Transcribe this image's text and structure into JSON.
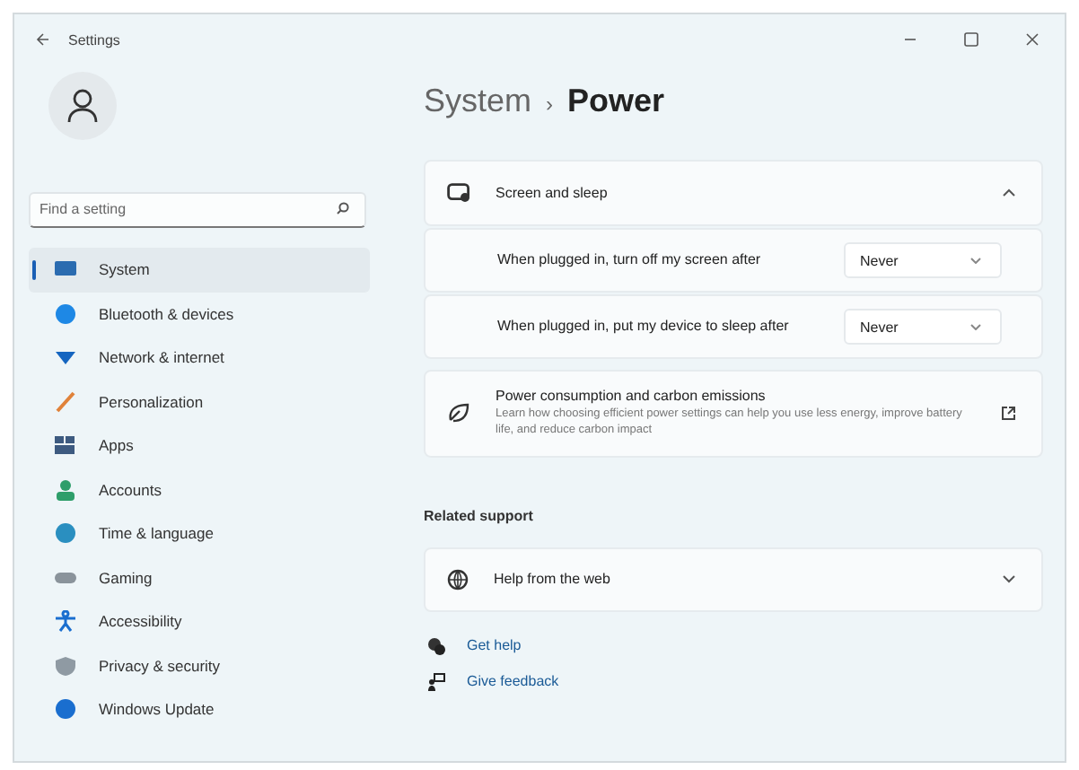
{
  "window": {
    "title": "Settings"
  },
  "search": {
    "placeholder": "Find a setting"
  },
  "sidebar": {
    "items": [
      {
        "label": "System",
        "selected": true
      },
      {
        "label": "Bluetooth & devices",
        "selected": false
      },
      {
        "label": "Network & internet",
        "selected": false
      },
      {
        "label": "Personalization",
        "selected": false
      },
      {
        "label": "Apps",
        "selected": false
      },
      {
        "label": "Accounts",
        "selected": false
      },
      {
        "label": "Time & language",
        "selected": false
      },
      {
        "label": "Gaming",
        "selected": false
      },
      {
        "label": "Accessibility",
        "selected": false
      },
      {
        "label": "Privacy & security",
        "selected": false
      },
      {
        "label": "Windows Update",
        "selected": false
      }
    ]
  },
  "breadcrumb": {
    "parent": "System",
    "separator": "›",
    "current": "Power"
  },
  "screen_and_sleep": {
    "title": "Screen and sleep",
    "expanded": true,
    "settings": [
      {
        "label": "When plugged in, turn off my screen after",
        "value": "Never"
      },
      {
        "label": "When plugged in, put my device to sleep after",
        "value": "Never"
      }
    ]
  },
  "power_card": {
    "title": "Power consumption and carbon emissions",
    "description": "Learn how choosing efficient power settings can help you use less energy, improve battery life, and reduce carbon impact"
  },
  "related_support": {
    "heading": "Related support",
    "items": [
      {
        "title": "Help from the web",
        "expanded": false
      }
    ]
  },
  "links": [
    "Get help",
    "Give feedback"
  ]
}
